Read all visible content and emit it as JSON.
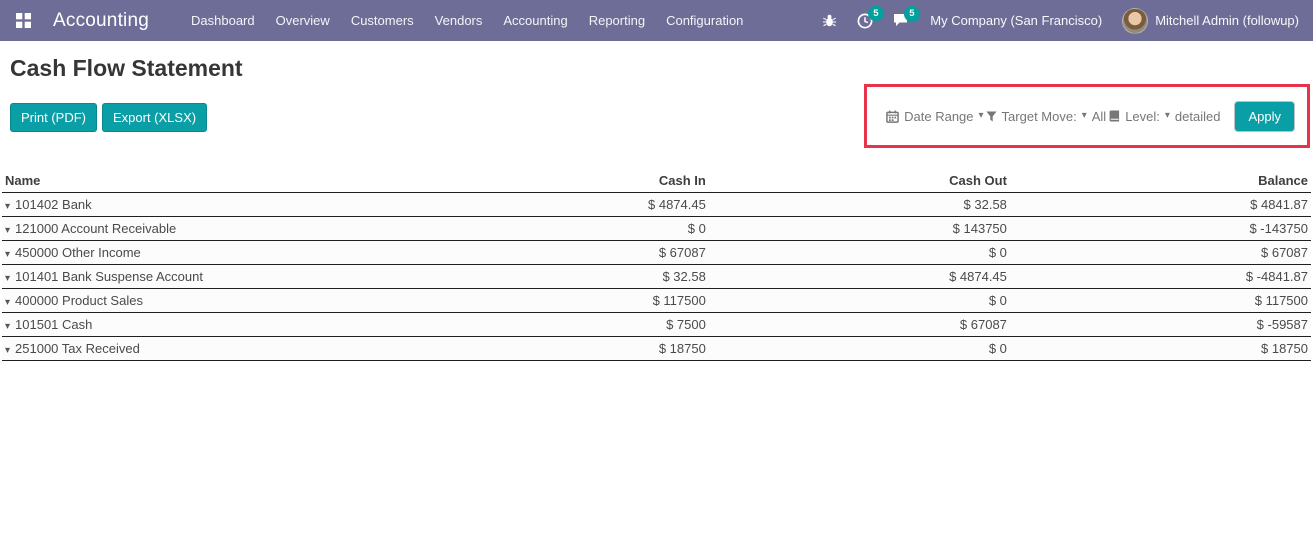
{
  "colors": {
    "navbar_bg": "#6e6d97",
    "accent": "#0a9fa7",
    "badge": "#00a09d",
    "highlight": "#e73249"
  },
  "icons": {
    "caret_down": "▾"
  },
  "navbar": {
    "brand": "Accounting",
    "menu_items": [
      "Dashboard",
      "Overview",
      "Customers",
      "Vendors",
      "Accounting",
      "Reporting",
      "Configuration"
    ],
    "activities_badge": "5",
    "messages_badge": "5",
    "company": "My Company (San Francisco)",
    "user": "Mitchell Admin (followup)"
  },
  "page": {
    "title": "Cash Flow Statement",
    "print_label": "Print (PDF)",
    "export_label": "Export (XLSX)"
  },
  "filters": {
    "date_range_label": "Date Range",
    "target_move_label": "Target Move:",
    "target_move_value": "All",
    "level_label": "Level:",
    "level_value": "detailed",
    "apply_label": "Apply"
  },
  "table": {
    "columns": [
      "Name",
      "Cash In",
      "Cash Out",
      "Balance"
    ],
    "rows": [
      {
        "name": "101402 Bank",
        "cash_in": "$ 4874.45",
        "cash_out": "$ 32.58",
        "balance": "$ 4841.87"
      },
      {
        "name": "121000 Account Receivable",
        "cash_in": "$ 0",
        "cash_out": "$ 143750",
        "balance": "$ -143750"
      },
      {
        "name": "450000 Other Income",
        "cash_in": "$ 67087",
        "cash_out": "$ 0",
        "balance": "$ 67087"
      },
      {
        "name": "101401 Bank Suspense Account",
        "cash_in": "$ 32.58",
        "cash_out": "$ 4874.45",
        "balance": "$ -4841.87"
      },
      {
        "name": "400000 Product Sales",
        "cash_in": "$ 117500",
        "cash_out": "$ 0",
        "balance": "$ 117500"
      },
      {
        "name": "101501 Cash",
        "cash_in": "$ 7500",
        "cash_out": "$ 67087",
        "balance": "$ -59587"
      },
      {
        "name": "251000 Tax Received",
        "cash_in": "$ 18750",
        "cash_out": "$ 0",
        "balance": "$ 18750"
      }
    ]
  }
}
